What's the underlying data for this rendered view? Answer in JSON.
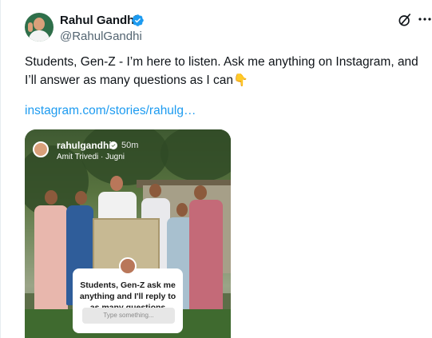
{
  "author": {
    "name": "Rahul Gandhi",
    "handle": "@RahulGandhi",
    "verified": true,
    "verified_color": "#1d9bf0"
  },
  "icons": {
    "grok": "grok-icon",
    "more": "more-options-icon",
    "verified": "verified-badge-icon"
  },
  "post": {
    "text": "Students, Gen-Z - I’m here to listen. Ask me anything on Instagram, and I’ll answer as many questions as I can",
    "emoji": "👇",
    "link": "instagram.com/stories/rahulg…"
  },
  "media": {
    "story_user": "rahulgandhi",
    "story_time": "50m",
    "story_music": "Amit Trivedi · Jugni",
    "question_text": "Students, Gen-Z ask me anything and I'll reply to as many questions",
    "question_placeholder": "Type something..."
  },
  "colors": {
    "text_primary": "#0f1419",
    "text_secondary": "#536471",
    "link": "#1d9bf0"
  }
}
